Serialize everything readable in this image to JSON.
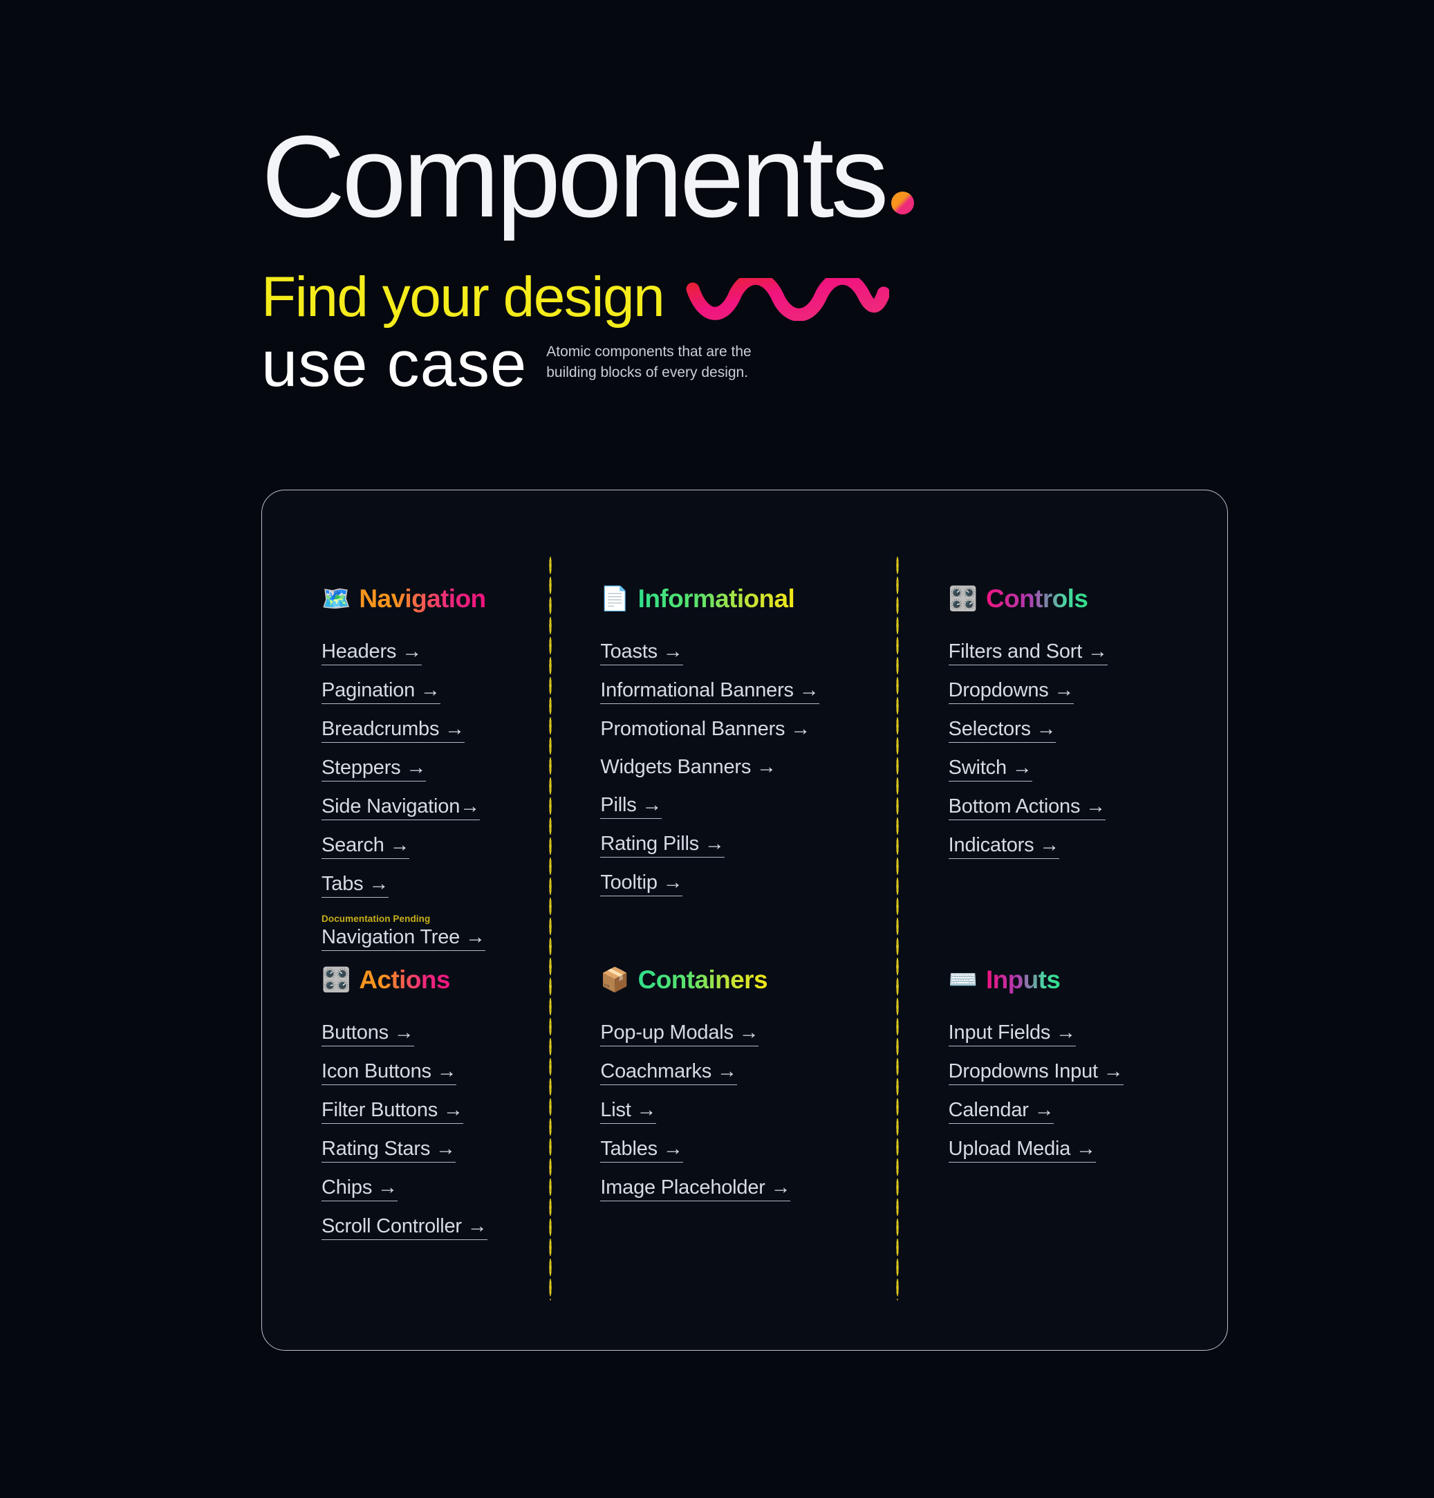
{
  "hero": {
    "title": "Components",
    "subtitle_line1": "Find your design",
    "subtitle_line2": "use case",
    "blurb_line1": "Atomic components that are the",
    "blurb_line2": "building blocks of every design.",
    "dot_gradient_from": "#f7941e",
    "dot_gradient_to": "#ee2a7b",
    "squiggle_from": "#e8232a",
    "squiggle_to": "#ee2a7b",
    "title_color": "#f2f4f8",
    "subtitle_line1_color": "#f5ec1c",
    "subtitle_line2_color": "#ffffff",
    "blurb_color": "#c9ced8"
  },
  "card": {
    "border_color": "#b9bfcb",
    "background": "#080c15",
    "divider_dot_color": "#d8c41f"
  },
  "categories": [
    {
      "name": "Navigation",
      "icon": "world-map-icon",
      "icon_glyph": "🗺️",
      "gradient": "orange-pink",
      "links": [
        {
          "label": "Headers →",
          "underlined": true,
          "pending": null
        },
        {
          "label": "Pagination →",
          "underlined": true,
          "pending": null
        },
        {
          "label": "Breadcrumbs →",
          "underlined": true,
          "pending": null
        },
        {
          "label": "Steppers →",
          "underlined": true,
          "pending": null
        },
        {
          "label": "Side Navigation→",
          "underlined": true,
          "pending": null
        },
        {
          "label": "Search →",
          "underlined": true,
          "pending": null
        },
        {
          "label": "Tabs →",
          "underlined": true,
          "pending": null
        },
        {
          "label": "Navigation Tree →",
          "underlined": true,
          "pending": "Documentation Pending"
        }
      ]
    },
    {
      "name": "Informational",
      "icon": "document-icon",
      "icon_glyph": "📄",
      "gradient": "green-yellow",
      "links": [
        {
          "label": "Toasts →",
          "underlined": true,
          "pending": null
        },
        {
          "label": "Informational Banners →",
          "underlined": true,
          "pending": null
        },
        {
          "label": "Promotional Banners →",
          "underlined": false,
          "pending": null
        },
        {
          "label": "Widgets Banners →",
          "underlined": false,
          "pending": null
        },
        {
          "label": "Pills →",
          "underlined": true,
          "pending": null
        },
        {
          "label": "Rating Pills →",
          "underlined": true,
          "pending": null
        },
        {
          "label": "Tooltip →",
          "underlined": true,
          "pending": null
        }
      ]
    },
    {
      "name": "Controls",
      "icon": "control-knobs-icon",
      "icon_glyph": "🎛️",
      "gradient": "pink-green",
      "links": [
        {
          "label": "Filters and Sort →",
          "underlined": true,
          "pending": null
        },
        {
          "label": "Dropdowns →",
          "underlined": true,
          "pending": null
        },
        {
          "label": "Selectors →",
          "underlined": true,
          "pending": null
        },
        {
          "label": "Switch →",
          "underlined": true,
          "pending": null
        },
        {
          "label": "Bottom Actions →",
          "underlined": true,
          "pending": null
        },
        {
          "label": "Indicators →",
          "underlined": true,
          "pending": null
        }
      ]
    },
    {
      "name": "Actions",
      "icon": "control-knobs-icon",
      "icon_glyph": "🎛️",
      "gradient": "orange-pink",
      "links": [
        {
          "label": "Buttons →",
          "underlined": true,
          "pending": null
        },
        {
          "label": "Icon Buttons →",
          "underlined": true,
          "pending": null
        },
        {
          "label": "Filter Buttons →",
          "underlined": true,
          "pending": null
        },
        {
          "label": "Rating Stars →",
          "underlined": true,
          "pending": null
        },
        {
          "label": "Chips →",
          "underlined": true,
          "pending": null
        },
        {
          "label": "Scroll Controller →",
          "underlined": true,
          "pending": null
        }
      ]
    },
    {
      "name": "Containers",
      "icon": "package-box-icon",
      "icon_glyph": "📦",
      "gradient": "green-yellow",
      "links": [
        {
          "label": "Pop-up Modals →",
          "underlined": true,
          "pending": null
        },
        {
          "label": "Coachmarks →",
          "underlined": true,
          "pending": null
        },
        {
          "label": "List →",
          "underlined": true,
          "pending": null
        },
        {
          "label": "Tables →",
          "underlined": true,
          "pending": null
        },
        {
          "label": "Image Placeholder →",
          "underlined": true,
          "pending": null
        }
      ]
    },
    {
      "name": "Inputs",
      "icon": "keyboard-icon",
      "icon_glyph": "⌨️",
      "gradient": "pink-green",
      "links": [
        {
          "label": "Input Fields →",
          "underlined": true,
          "pending": null
        },
        {
          "label": "Dropdowns Input →",
          "underlined": true,
          "pending": null
        },
        {
          "label": "Calendar →",
          "underlined": true,
          "pending": null
        },
        {
          "label": "Upload Media →",
          "underlined": true,
          "pending": null
        }
      ]
    }
  ]
}
